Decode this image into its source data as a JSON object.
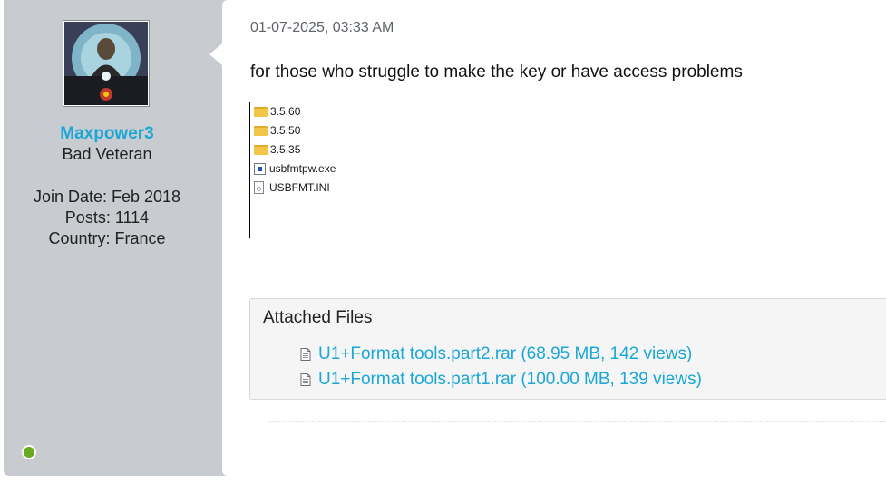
{
  "user": {
    "username": "Maxpower3",
    "title": "Bad Veteran",
    "join_date": "Join Date: Feb 2018",
    "posts": "Posts: 1114",
    "country": "Country: France",
    "online_status_color": "#6aaa1e"
  },
  "post": {
    "date": "01-07-2025, 03:33 AM",
    "text": "for those who struggle to make the key or have access problems",
    "screenshot_files": [
      {
        "name": "3.5.60",
        "icon": "folder-icon"
      },
      {
        "name": "3.5.50",
        "icon": "folder-icon"
      },
      {
        "name": "3.5.35",
        "icon": "folder-icon"
      },
      {
        "name": "usbfmtpw.exe",
        "icon": "exe-icon"
      },
      {
        "name": "USBFMT.INI",
        "icon": "ini-file-icon"
      }
    ]
  },
  "attachments": {
    "title": "Attached Files",
    "files": [
      {
        "label": "U1+Format tools.part2.rar (68.95 MB, 142 views)",
        "icon": "file-icon"
      },
      {
        "label": "U1+Format tools.part1.rar (100.00 MB, 139 views)",
        "icon": "file-icon"
      }
    ]
  },
  "colors": {
    "accent_link": "#1aa7d6",
    "sidebar_bg": "#c8cbcf"
  }
}
